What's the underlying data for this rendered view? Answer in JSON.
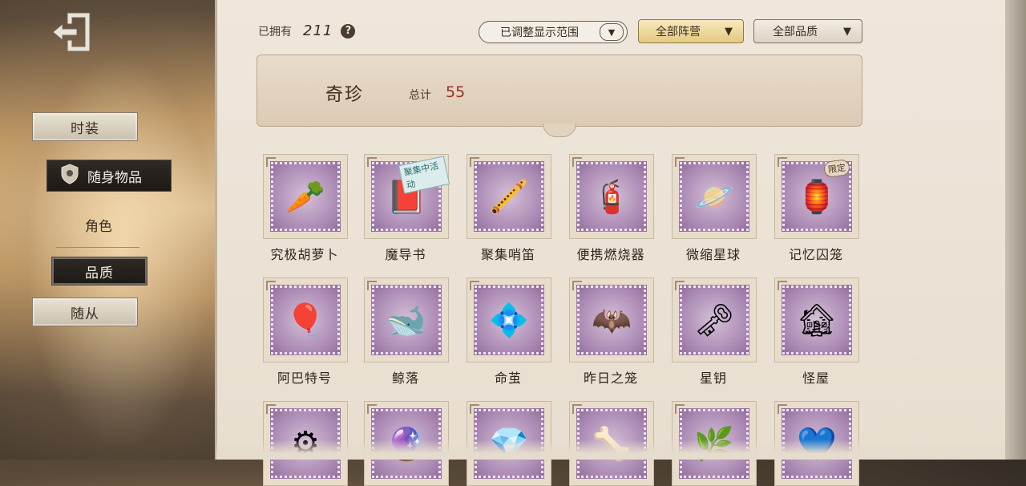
{
  "header": {
    "owned_label": "已拥有",
    "owned_count": "211",
    "help": "?",
    "filter_range": "已调整显示范围",
    "filter_faction": "全部阵营",
    "filter_quality": "全部品质"
  },
  "sidebar": {
    "items": [
      {
        "label": "时装"
      },
      {
        "label": "随身物品"
      },
      {
        "label": "角色"
      },
      {
        "label": "品质"
      },
      {
        "label": "随从"
      }
    ]
  },
  "banner": {
    "title": "奇珍",
    "total_label": "总计",
    "total_count": "55"
  },
  "items": [
    {
      "name": "究极胡萝卜",
      "icon": "🥕"
    },
    {
      "name": "魔导书",
      "icon": "📕",
      "tag": "聚集中活动"
    },
    {
      "name": "聚集哨笛",
      "icon": "🪈"
    },
    {
      "name": "便携燃烧器",
      "icon": "🧯"
    },
    {
      "name": "微缩星球",
      "icon": "🪐"
    },
    {
      "name": "记忆囚笼",
      "icon": "🏮",
      "tag": "限定"
    },
    {
      "name": "阿巴特号",
      "icon": "🎈"
    },
    {
      "name": "鲸落",
      "icon": "🐋"
    },
    {
      "name": "命茧",
      "icon": "💠"
    },
    {
      "name": "昨日之笼",
      "icon": "🦇"
    },
    {
      "name": "星钥",
      "icon": "🗝"
    },
    {
      "name": "怪屋",
      "icon": "🏚"
    },
    {
      "name": "",
      "icon": "⚙"
    },
    {
      "name": "",
      "icon": "🔮"
    },
    {
      "name": "",
      "icon": "💎"
    },
    {
      "name": "",
      "icon": "🦴"
    },
    {
      "name": "",
      "icon": "🌿"
    },
    {
      "name": "",
      "icon": "💙"
    }
  ],
  "colors": {
    "accent_red": "#9a2f25",
    "stamp_purple": "#a886b1"
  }
}
